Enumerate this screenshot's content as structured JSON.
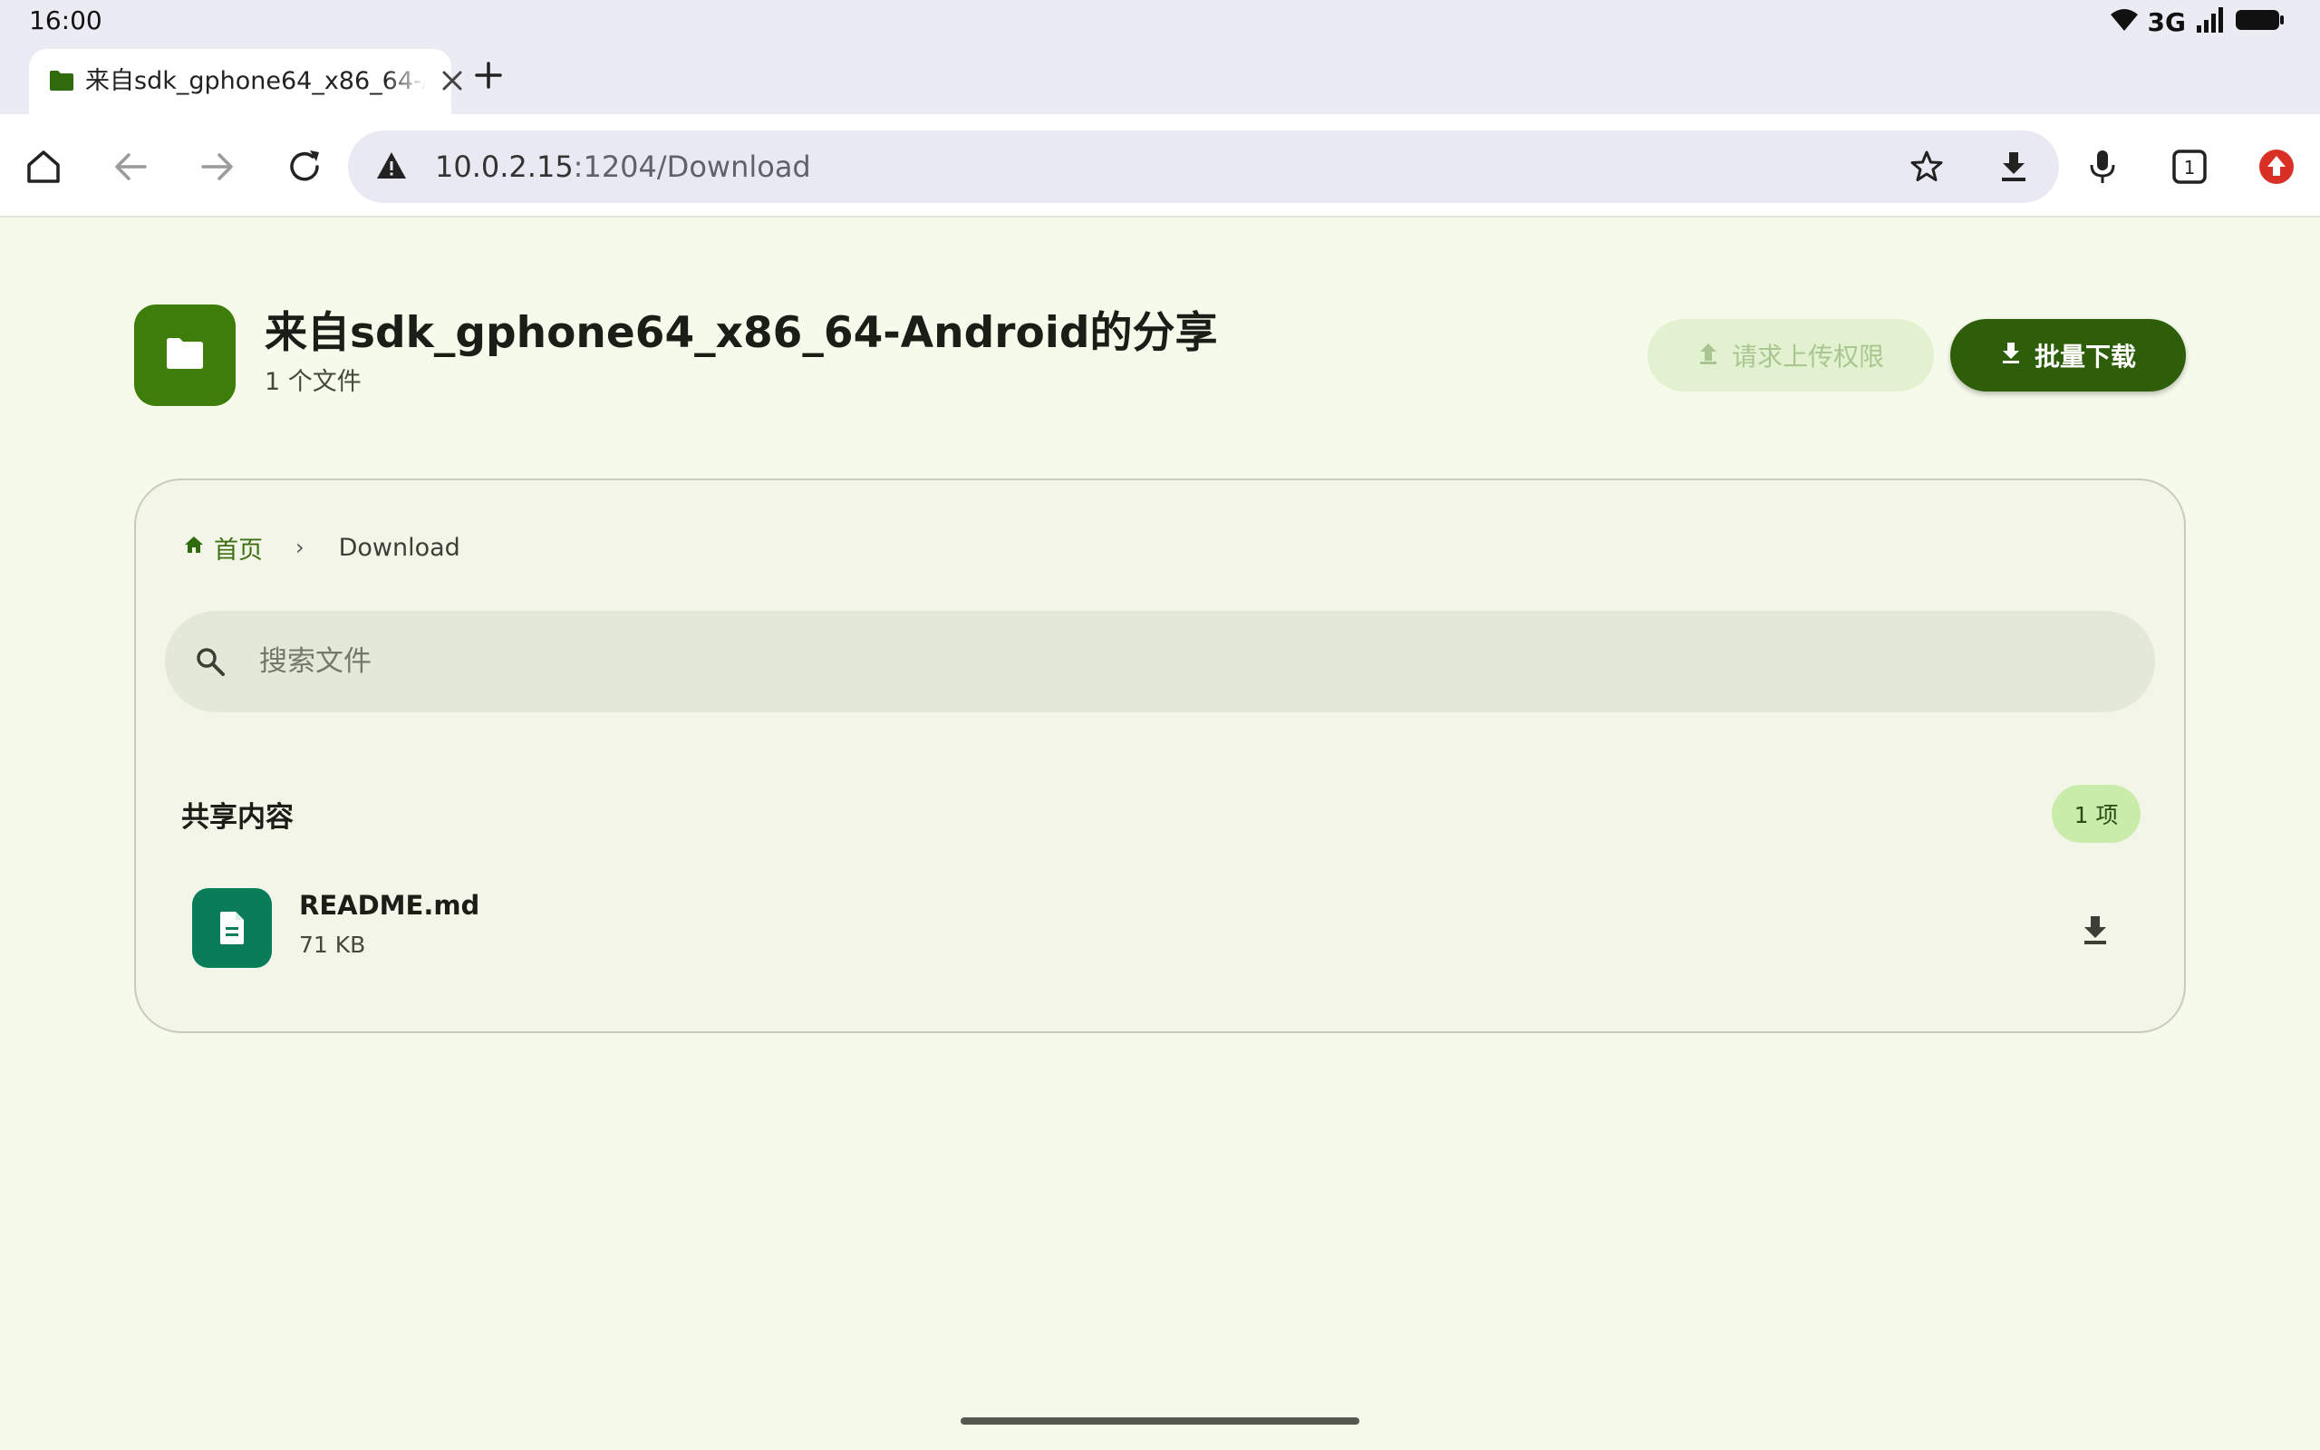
{
  "status_bar": {
    "time": "16:00",
    "network": "3G",
    "icons": [
      "wifi-icon",
      "signal-icon",
      "battery-icon"
    ]
  },
  "browser": {
    "tab": {
      "title": "来自sdk_gphone64_x86_64-Android的分享",
      "favicon": "folder-icon",
      "close_icon": "close-icon"
    },
    "new_tab_icon": "plus-icon",
    "url_host": "10.0.2.15",
    "url_path": ":1204/Download",
    "toolbar_icons": [
      "home-icon",
      "back-icon",
      "forward-icon",
      "reload-icon",
      "warning-icon",
      "star-icon",
      "download-icon",
      "mic-icon",
      "tab-switcher-icon",
      "extension-icon"
    ],
    "tab_count": "1"
  },
  "header": {
    "title": "来自sdk_gphone64_x86_64-Android的分享",
    "subtitle": "1 个文件",
    "upload_button": "请求上传权限",
    "download_all_button": "批量下载"
  },
  "breadcrumb": {
    "home": "首页",
    "separator": "›",
    "current": "Download"
  },
  "search": {
    "placeholder": "搜索文件",
    "value": ""
  },
  "section": {
    "title": "共享内容",
    "count": "1 项"
  },
  "files": [
    {
      "name": "README.md",
      "size": "71 KB",
      "icon": "document-icon"
    }
  ],
  "colors": {
    "page_bg": "#f5faeb",
    "primary": "#2f5e0a",
    "folder_badge": "#3d7d09",
    "file_icon": "#0a7c5a",
    "chip": "#c9ecaa",
    "disabled_button": "#e2f1cf"
  }
}
